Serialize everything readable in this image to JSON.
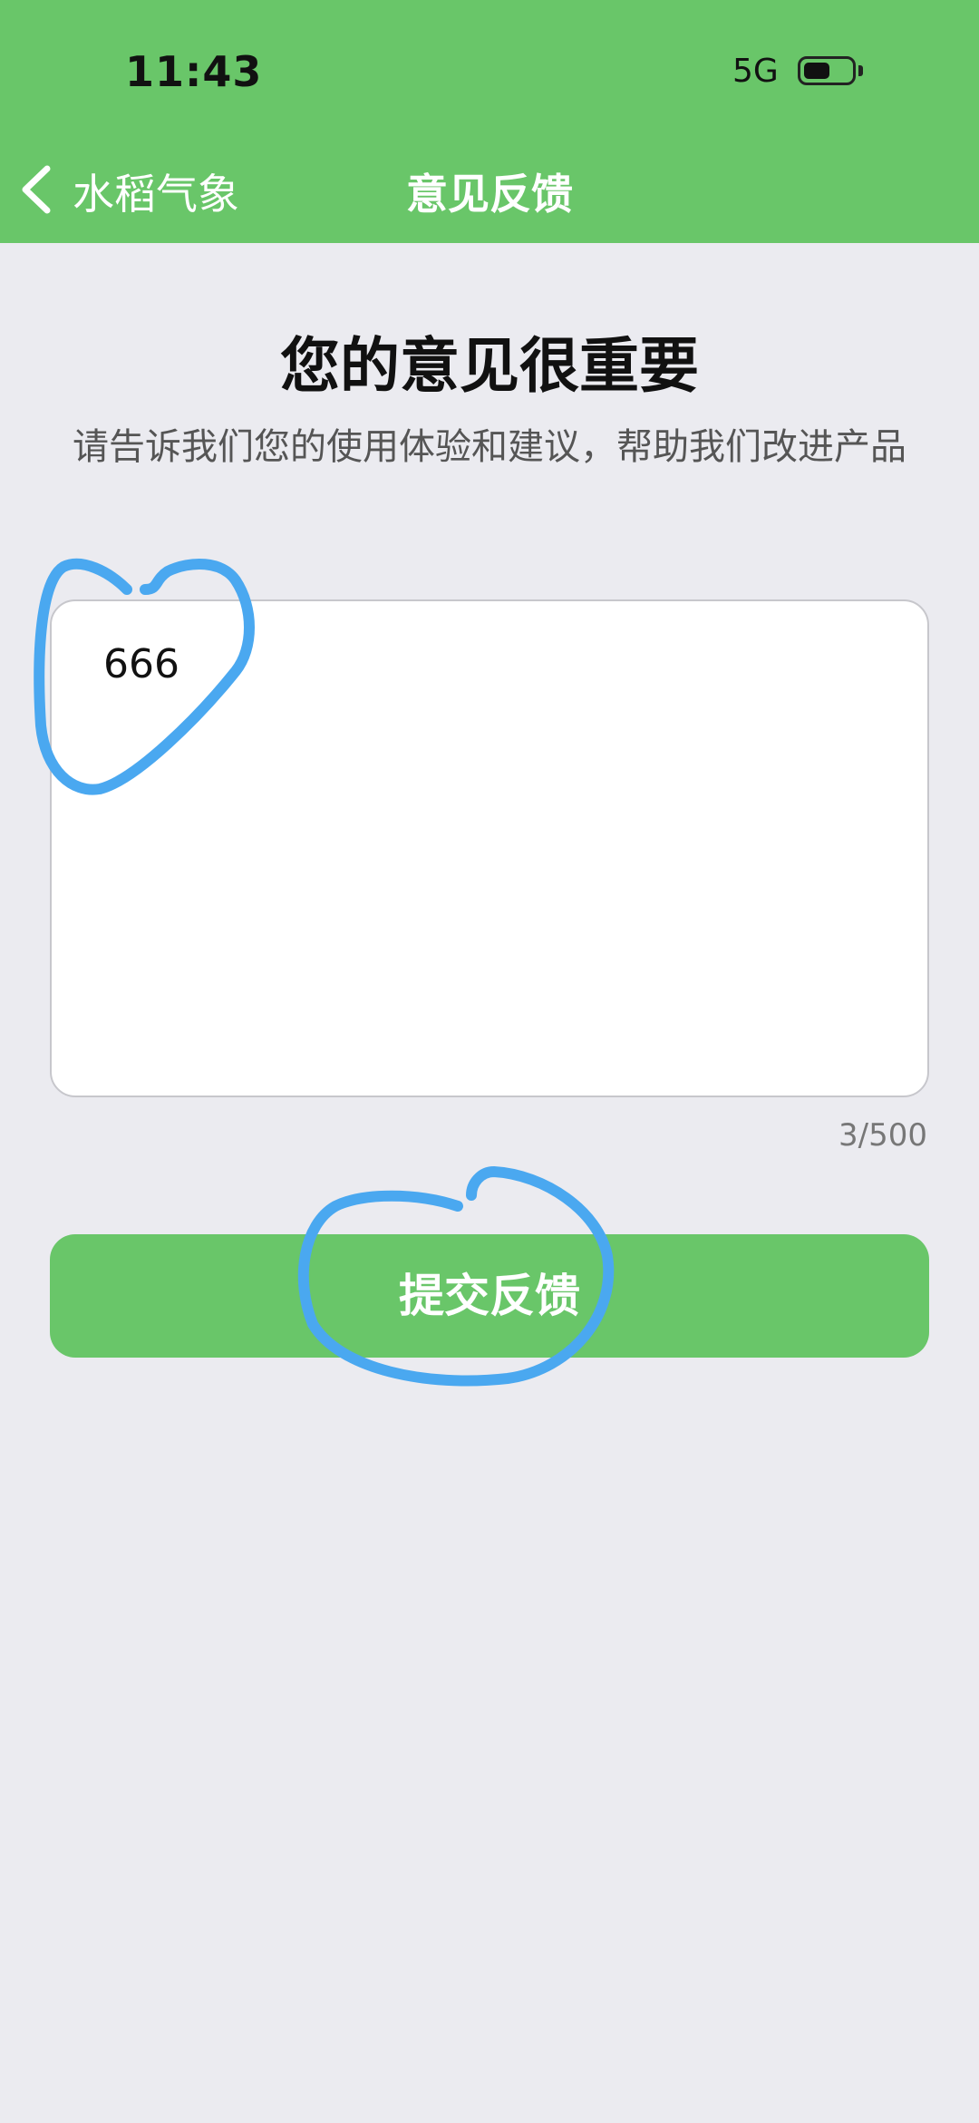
{
  "status_bar": {
    "time": "11:43",
    "network": "5G",
    "battery_level": 0.55
  },
  "nav": {
    "back_label": "水稻气象",
    "title": "意见反馈"
  },
  "content": {
    "heading": "您的意见很重要",
    "subtitle": "请告诉我们您的使用体验和建议，帮助我们改进产品",
    "feedback_value": "666",
    "char_count": "3/500",
    "submit_label": "提交反馈"
  },
  "colors": {
    "accent": "#69c669",
    "annotation": "#4aa8f0"
  }
}
